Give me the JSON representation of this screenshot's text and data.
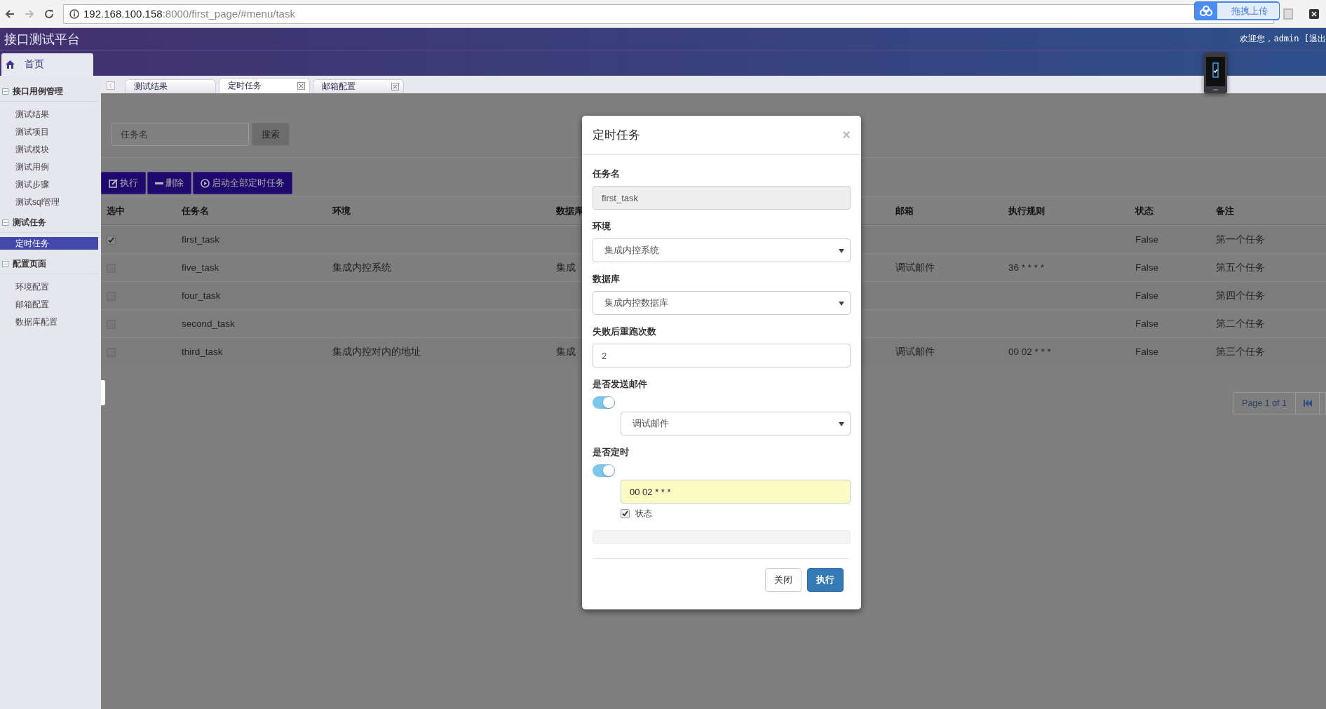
{
  "browser": {
    "url_host": "192.168.100.158",
    "url_rest": ":8000/first_page/#menu/task",
    "upload_widget": "拖拽上传"
  },
  "header": {
    "title": "接口测试平台",
    "welcome": "欢迎您，admin [退出",
    "home_tab": "首页"
  },
  "tabs": [
    {
      "label": "测试结果",
      "selected": false,
      "closable": false
    },
    {
      "label": "定时任务",
      "selected": true,
      "closable": true
    },
    {
      "label": "邮箱配置",
      "selected": false,
      "closable": true
    }
  ],
  "sidebar": {
    "groups": [
      {
        "title": "接口用例管理",
        "items": [
          {
            "label": "测试结果",
            "selected": false
          },
          {
            "label": "测试项目",
            "selected": false
          },
          {
            "label": "测试模块",
            "selected": false
          },
          {
            "label": "测试用例",
            "selected": false
          },
          {
            "label": "测试步骤",
            "selected": false
          },
          {
            "label": "测试sql管理",
            "selected": false
          }
        ]
      },
      {
        "title": "测试任务",
        "items": [
          {
            "label": "定时任务",
            "selected": true
          }
        ]
      },
      {
        "title": "配置页面",
        "items": [
          {
            "label": "环境配置",
            "selected": false
          },
          {
            "label": "邮箱配置",
            "selected": false
          },
          {
            "label": "数据库配置",
            "selected": false
          }
        ]
      }
    ]
  },
  "search": {
    "placeholder": "任务名",
    "button": "搜索"
  },
  "toolbar": [
    {
      "label": "执行",
      "kind": "edit"
    },
    {
      "label": "删除",
      "kind": "minus"
    },
    {
      "label": "启动全部定时任务",
      "kind": "play"
    }
  ],
  "table": {
    "check_column": "选中",
    "columns": [
      "任务名",
      "环境",
      "数据库",
      "邮箱",
      "执行规则",
      "状态",
      "备注"
    ],
    "rows": [
      {
        "checked": true,
        "cells": [
          "first_task",
          "",
          "",
          "",
          "",
          "False",
          "第一个任务"
        ]
      },
      {
        "checked": false,
        "cells": [
          "five_task",
          "集成内控系统",
          "集成",
          "调试邮件",
          "36 * * * *",
          "False",
          "第五个任务"
        ]
      },
      {
        "checked": false,
        "cells": [
          "four_task",
          "",
          "",
          "",
          "",
          "False",
          "第四个任务"
        ]
      },
      {
        "checked": false,
        "cells": [
          "second_task",
          "",
          "",
          "",
          "",
          "False",
          "第二个任务"
        ]
      },
      {
        "checked": false,
        "cells": [
          "third_task",
          "集成内控对内的地址",
          "集成",
          "调试邮件",
          "00 02 * * *",
          "False",
          "第三个任务"
        ]
      }
    ]
  },
  "pagination": {
    "info": "Page 1 of 1"
  },
  "modal": {
    "title": "定时任务",
    "close": "×",
    "fields": [
      {
        "label": "任务名",
        "kind": "readonly",
        "value": "first_task"
      },
      {
        "label": "环境",
        "kind": "select",
        "value": "集成内控系统"
      },
      {
        "label": "数据库",
        "kind": "select",
        "value": "集成内控数据库"
      },
      {
        "label": "失败后重跑次数",
        "kind": "input",
        "value": "2"
      }
    ],
    "mail": {
      "label": "是否发送邮件",
      "on": true,
      "value": "调试邮件"
    },
    "schedule": {
      "label": "是否定时",
      "on": true,
      "value": "00 02 * * *",
      "status_label": "状态",
      "status_checked": true
    },
    "progress": {
      "level": 0
    },
    "buttons": [
      {
        "label": "关闭",
        "kind": "default"
      },
      {
        "label": "执行",
        "kind": "primary"
      }
    ]
  }
}
